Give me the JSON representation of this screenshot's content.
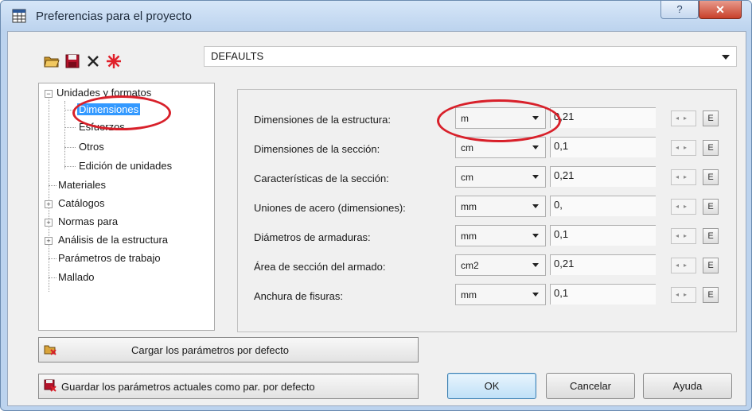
{
  "window": {
    "title": "Preferencias para el proyecto",
    "help_glyph": "?",
    "close_glyph": "✕"
  },
  "toolbar": {
    "preset_value": "DEFAULTS"
  },
  "tree": {
    "units_formats": "Unidades y formatos",
    "dimensions": "Dimensiones",
    "forces": "Esfuerzos",
    "others": "Otros",
    "unit_edit": "Edición de unidades",
    "materials": "Materiales",
    "catalogs": "Catálogos",
    "codes": "Normas para",
    "analysis": "Análisis de la estructura",
    "work_params": "Parámetros de trabajo",
    "mesh": "Mallado"
  },
  "rows": [
    {
      "label": "Dimensiones de la estructura:",
      "unit": "m",
      "value": "0,21",
      "ebtn": "E"
    },
    {
      "label": "Dimensiones de la sección:",
      "unit": "cm",
      "value": "0,1",
      "ebtn": "E"
    },
    {
      "label": "Características de la sección:",
      "unit": "cm",
      "value": "0,21",
      "ebtn": "E"
    },
    {
      "label": "Uniones de acero (dimensiones):",
      "unit": "mm",
      "value": "0,",
      "ebtn": "E"
    },
    {
      "label": "Diámetros de armaduras:",
      "unit": "mm",
      "value": "0,1",
      "ebtn": "E"
    },
    {
      "label": "Área de sección del armado:",
      "unit": "cm2",
      "value": "0,21",
      "ebtn": "E"
    },
    {
      "label": "Anchura de fisuras:",
      "unit": "mm",
      "value": "0,1",
      "ebtn": "E"
    }
  ],
  "actions": {
    "load_defaults": "Cargar los parámetros por defecto",
    "save_defaults": "Guardar los parámetros actuales como par. por defecto",
    "ok": "OK",
    "cancel": "Cancelar",
    "help": "Ayuda"
  },
  "colors": {
    "highlight_ellipse": "#d8202a",
    "selection": "#3399ff"
  },
  "icons": {
    "open": "folder-open-icon",
    "save": "floppy-disk-icon",
    "delete": "x-delete-icon",
    "new": "red-star-icon"
  }
}
